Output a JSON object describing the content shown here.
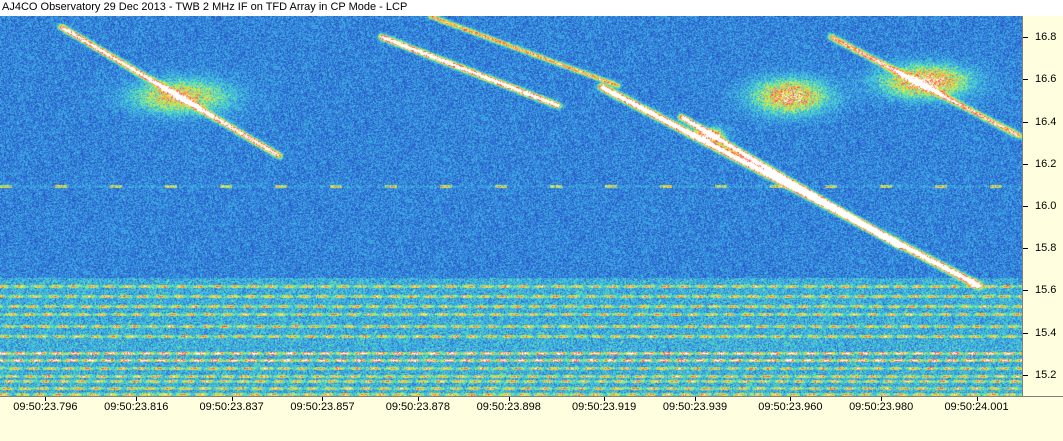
{
  "window": {
    "title": "AJ4CO Observatory 29 Dec 2013 - TWB 2 MHz IF on TFD Array in CP Mode - LCP"
  },
  "colors": {
    "background": "#1d3aa6",
    "axis_background": "#ffffe0",
    "palette": [
      "#0b1f8a",
      "#1d3aa6",
      "#2f6fd8",
      "#3fb0e6",
      "#4fe0c0",
      "#c8f050",
      "#ffd040",
      "#ff4040",
      "#ffffff"
    ]
  },
  "axes": {
    "y": {
      "min": 15.1,
      "max": 16.9,
      "ticks": [
        "15.2",
        "15.4",
        "15.6",
        "15.8",
        "16.0",
        "16.2",
        "16.4",
        "16.6",
        "16.8"
      ]
    },
    "x": {
      "min": 23.786,
      "max": 24.011,
      "ticks": [
        {
          "label": "09:50:23.796",
          "value": 23.796
        },
        {
          "label": "09:50:23.816",
          "value": 23.816
        },
        {
          "label": "09:50:23.837",
          "value": 23.837
        },
        {
          "label": "09:50:23.857",
          "value": 23.857
        },
        {
          "label": "09:50:23.878",
          "value": 23.878
        },
        {
          "label": "09:50:23.898",
          "value": 23.898
        },
        {
          "label": "09:50:23.919",
          "value": 23.919
        },
        {
          "label": "09:50:23.939",
          "value": 23.939
        },
        {
          "label": "09:50:23.960",
          "value": 23.96
        },
        {
          "label": "09:50:23.980",
          "value": 23.98
        },
        {
          "label": "09:50:24.001",
          "value": 24.001
        }
      ]
    }
  }
}
